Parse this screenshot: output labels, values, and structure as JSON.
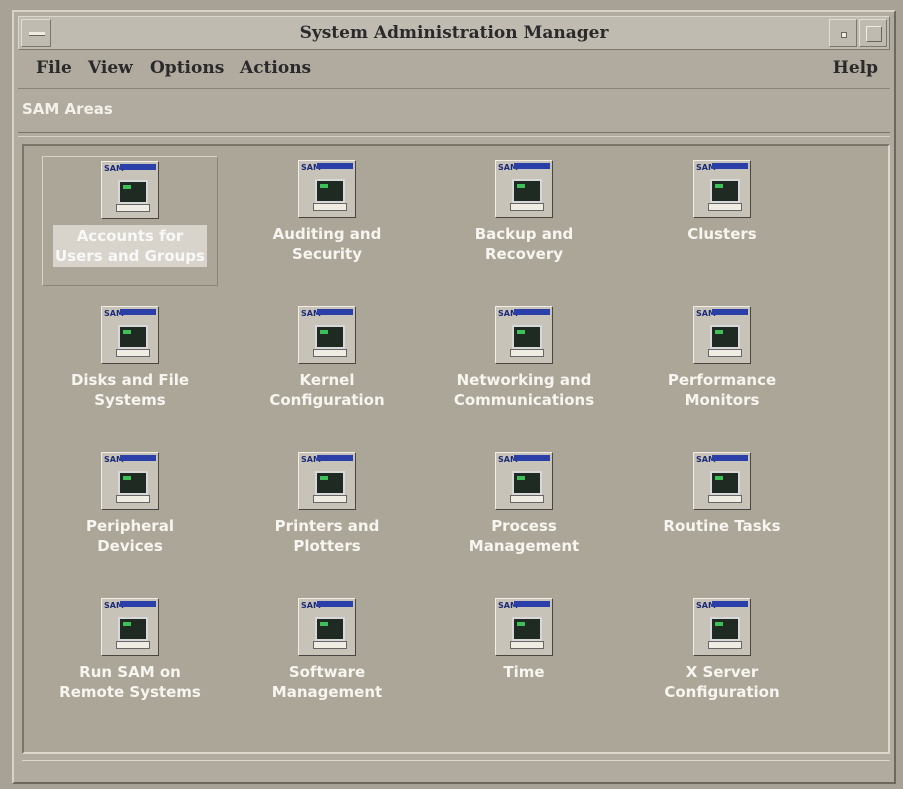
{
  "window": {
    "title": "System Administration Manager"
  },
  "menubar": {
    "file": "File",
    "view": "View",
    "options": "Options",
    "actions": "Actions",
    "help": "Help"
  },
  "areas_label": "SAM Areas",
  "icon_badge": "SAM",
  "areas": [
    {
      "label": "Accounts for\nUsers and Groups",
      "icon": "users-groups-icon",
      "selected": true
    },
    {
      "label": "Auditing and\nSecurity",
      "icon": "key-security-icon"
    },
    {
      "label": "Backup and\nRecovery",
      "icon": "backup-icon"
    },
    {
      "label": "Clusters",
      "icon": "clusters-icon"
    },
    {
      "label": "Disks and File\nSystems",
      "icon": "disk-icon"
    },
    {
      "label": "Kernel\nConfiguration",
      "icon": "kernel-heart-icon"
    },
    {
      "label": "Networking and\nCommunications",
      "icon": "network-icon"
    },
    {
      "label": "Performance\nMonitors",
      "icon": "performance-runner-icon"
    },
    {
      "label": "Peripheral\nDevices",
      "icon": "peripheral-icon"
    },
    {
      "label": "Printers and\nPlotters",
      "icon": "printer-icon"
    },
    {
      "label": "Process\nManagement",
      "icon": "process-icon"
    },
    {
      "label": "Routine Tasks",
      "icon": "routine-cycle-icon"
    },
    {
      "label": "Run SAM on\nRemote Systems",
      "icon": "remote-systems-icon"
    },
    {
      "label": "Software\nManagement",
      "icon": "software-disc-icon"
    },
    {
      "label": "Time",
      "icon": "clock-icon"
    },
    {
      "label": "X Server\nConfiguration",
      "icon": "x-server-icon"
    }
  ]
}
